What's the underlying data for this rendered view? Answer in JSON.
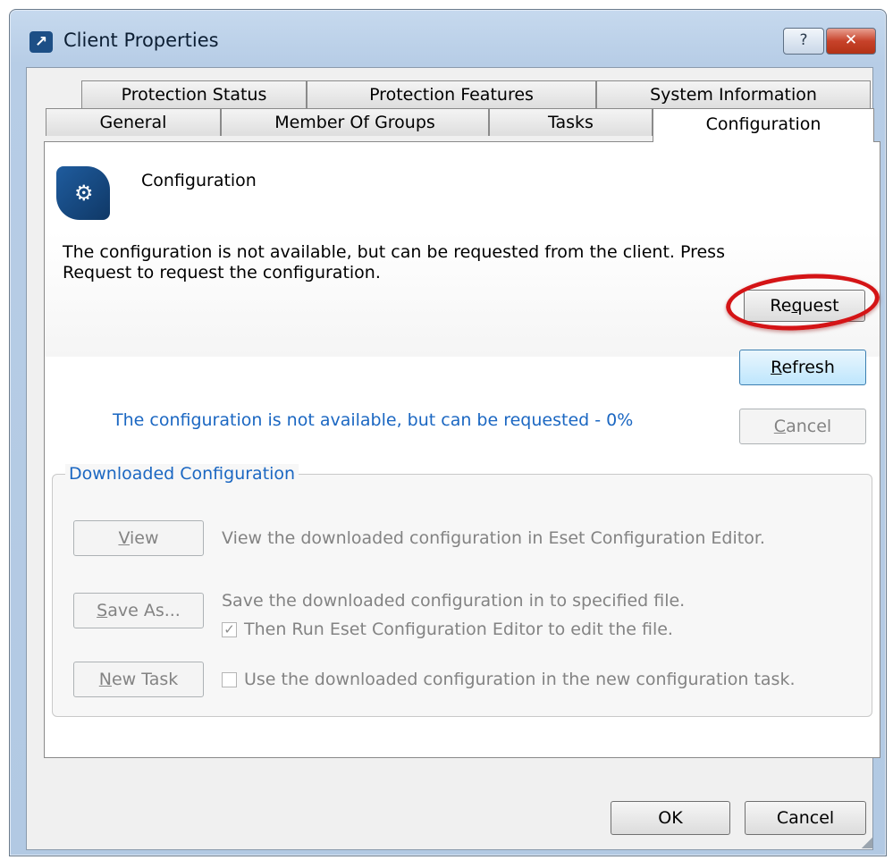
{
  "window": {
    "title": "Client Properties",
    "help_label": "?",
    "close_label": "✕"
  },
  "tabs": {
    "row1": [
      "Protection Status",
      "Protection Features",
      "System Information"
    ],
    "row2": [
      "General",
      "Member Of Groups",
      "Tasks",
      "Configuration"
    ],
    "active": "Configuration"
  },
  "configuration": {
    "heading": "Configuration",
    "info_line1": "The configuration is not available, but can be requested from the client. Press",
    "info_line2": "Request to request the configuration.",
    "status": "The configuration is not available, but can be requested - 0%",
    "request_pre": "Re",
    "request_key": "q",
    "request_post": "uest",
    "refresh_key": "R",
    "refresh_post": "efresh",
    "cancel_key": "C",
    "cancel_post": "ancel"
  },
  "downloaded": {
    "group_label": "Downloaded Configuration",
    "view_key": "V",
    "view_post": "iew",
    "view_desc": "View the downloaded configuration in Eset Configuration Editor.",
    "saveas_key": "S",
    "saveas_post": "ave As...",
    "saveas_desc": "Save the downloaded configuration in to specified file.",
    "run_editor_label": "Then Run Eset Configuration Editor to edit the file.",
    "run_editor_checked": true,
    "newtask_key": "N",
    "newtask_post": "ew Task",
    "newtask_desc": "Use the downloaded configuration in the new configuration task.",
    "newtask_checked": false
  },
  "footer": {
    "ok_label": "OK",
    "cancel_label": "Cancel"
  },
  "colors": {
    "link_blue": "#1b67c2",
    "highlight_red": "#d41416",
    "title_bar": "#b7cde6"
  }
}
